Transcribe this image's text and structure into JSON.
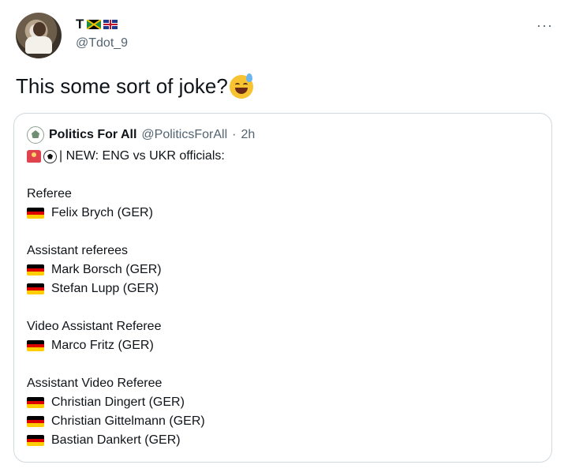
{
  "tweet": {
    "display_name": "T",
    "handle": "@Tdot_9",
    "more_label": "···",
    "text": "This some sort of joke?",
    "emoji": "sweat-smile-emoji"
  },
  "quote": {
    "author_name": "Politics For All",
    "author_handle": "@PoliticsForAll",
    "separator": "·",
    "time": "2h",
    "headline": "| NEW: ENG vs UKR officials:",
    "sections": [
      {
        "title": "Referee",
        "officials": [
          "Felix Brych (GER)"
        ]
      },
      {
        "title": "Assistant referees",
        "officials": [
          "Mark Borsch (GER)",
          "Stefan Lupp (GER)"
        ]
      },
      {
        "title": "Video Assistant Referee",
        "officials": [
          "Marco Fritz (GER)"
        ]
      },
      {
        "title": "Assistant Video Referee",
        "officials": [
          "Christian Dingert (GER)",
          "Christian Gittelmann (GER)",
          "Bastian Dankert (GER)"
        ]
      }
    ]
  },
  "icons": [
    "jamaica-flag-icon",
    "uk-flag-icon",
    "siren-icon",
    "soccer-ball-icon",
    "germany-flag-icon"
  ]
}
